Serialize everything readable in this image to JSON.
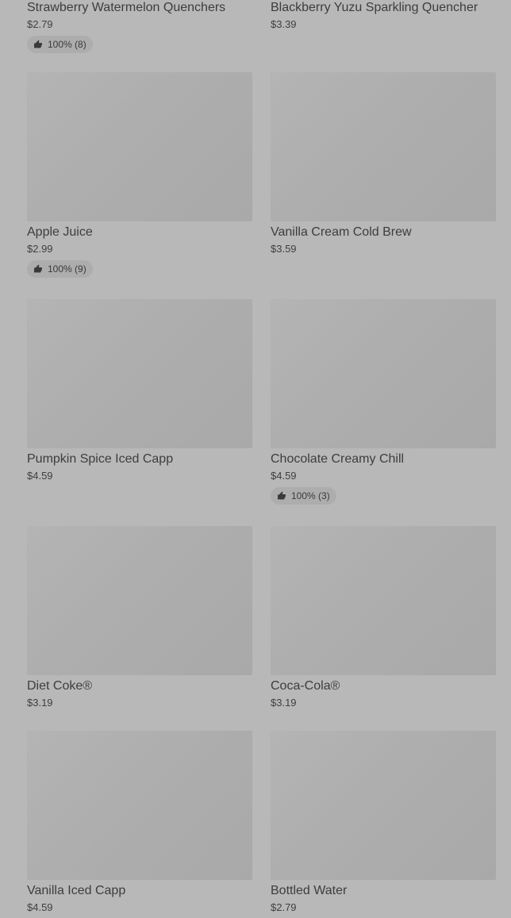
{
  "products": [
    {
      "name": "Strawberry Watermelon Quenchers",
      "price": "$2.79",
      "rating": "100% (8)"
    },
    {
      "name": "Blackberry Yuzu Sparkling Quencher",
      "price": "$3.39",
      "rating": null
    },
    {
      "name": "Apple Juice",
      "price": "$2.99",
      "rating": "100% (9)"
    },
    {
      "name": "Vanilla Cream Cold Brew",
      "price": "$3.59",
      "rating": null
    },
    {
      "name": "Pumpkin Spice Iced Capp",
      "price": "$4.59",
      "rating": null
    },
    {
      "name": "Chocolate Creamy Chill",
      "price": "$4.59",
      "rating": "100% (3)"
    },
    {
      "name": "Diet Coke®",
      "price": "$3.19",
      "rating": null
    },
    {
      "name": "Coca-Cola®",
      "price": "$3.19",
      "rating": null
    },
    {
      "name": "Vanilla Iced Capp",
      "price": "$4.59",
      "rating": null
    },
    {
      "name": "Bottled Water",
      "price": "$2.79",
      "rating": null
    }
  ],
  "icons": {
    "rating": "thumbs-up-icon"
  },
  "colors": {
    "background": "#b8b8b8",
    "thumbnail": "#adadad",
    "text": "#3a3a3a"
  }
}
